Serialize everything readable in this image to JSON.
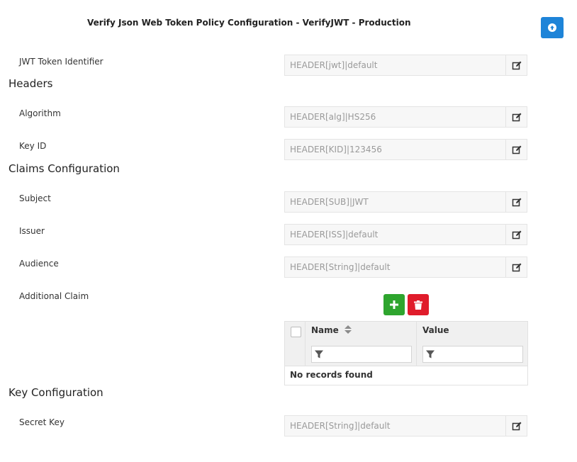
{
  "header": {
    "title": "Verify Json Web Token Policy Configuration - VerifyJWT - Production"
  },
  "jwt_token": {
    "label": "JWT Token Identifier",
    "value": "HEADER[jwt]|default"
  },
  "sections": {
    "headers": "Headers",
    "claims": "Claims Configuration",
    "key": "Key Configuration"
  },
  "headers": {
    "algorithm": {
      "label": "Algorithm",
      "value": "HEADER[alg]|HS256"
    },
    "key_id": {
      "label": "Key ID",
      "value": "HEADER[KID]|123456"
    }
  },
  "claims": {
    "subject": {
      "label": "Subject",
      "value": "HEADER[SUB]|JWT"
    },
    "issuer": {
      "label": "Issuer",
      "value": "HEADER[ISS]|default"
    },
    "audience": {
      "label": "Audience",
      "value": "HEADER[String]|default"
    },
    "additional": {
      "label": "Additional Claim"
    }
  },
  "claims_table": {
    "columns": [
      "Name",
      "Value"
    ],
    "empty_message": "No records found"
  },
  "key": {
    "secret": {
      "label": "Secret Key",
      "value": "HEADER[String]|default"
    }
  },
  "colors": {
    "primary": "#1e84d8",
    "add": "#2ea52e",
    "delete": "#e01c2b"
  },
  "icons": [
    "upload-icon",
    "edit-icon",
    "plus-icon",
    "trash-icon",
    "sort-icon",
    "filter-icon"
  ]
}
